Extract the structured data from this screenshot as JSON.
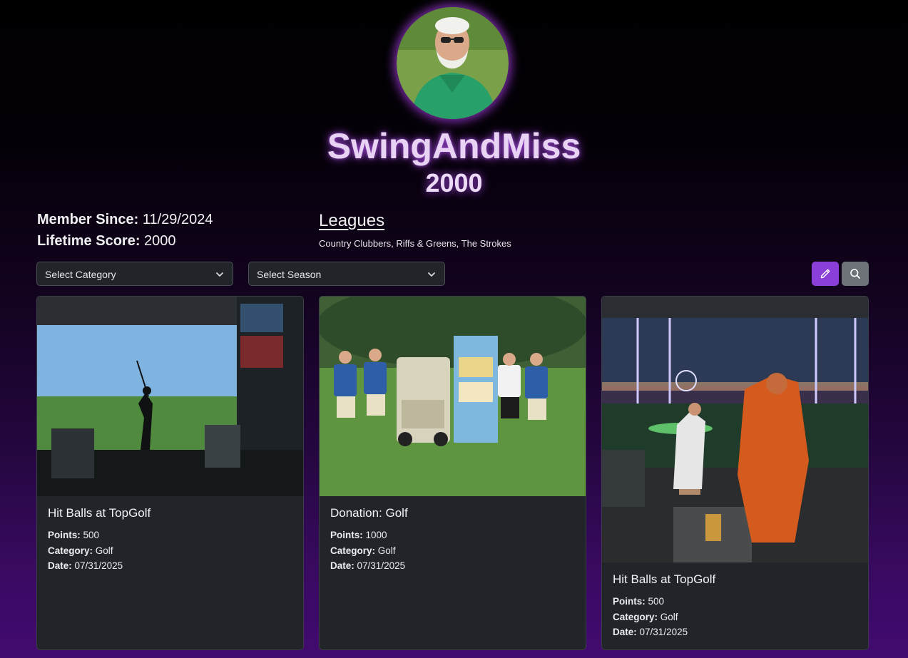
{
  "profile": {
    "username": "SwingAndMiss",
    "score": "2000",
    "member_since_label": "Member Since:",
    "member_since_value": "11/29/2024",
    "lifetime_score_label": "Lifetime Score:",
    "lifetime_score_value": "2000"
  },
  "leagues": {
    "heading": "Leagues",
    "list": "Country Clubbers, Riffs & Greens, The Strokes"
  },
  "filters": {
    "category_placeholder": "Select Category",
    "season_placeholder": "Select Season"
  },
  "toolbar": {
    "edit_icon": "pencil-icon",
    "search_icon": "search-icon"
  },
  "labels": {
    "points": "Points:",
    "category": "Category:",
    "date": "Date:"
  },
  "cards": [
    {
      "title": "Hit Balls at TopGolf",
      "points": "500",
      "category": "Golf",
      "date": "07/31/2025"
    },
    {
      "title": "Donation: Golf",
      "points": "1000",
      "category": "Golf",
      "date": "07/31/2025"
    },
    {
      "title": "Hit Balls at TopGolf",
      "points": "500",
      "category": "Golf",
      "date": "07/31/2025"
    }
  ],
  "colors": {
    "accent": "#8b3fd9",
    "glow": "#aa46eb",
    "card_bg": "#212529",
    "search_button": "#6e737a"
  }
}
